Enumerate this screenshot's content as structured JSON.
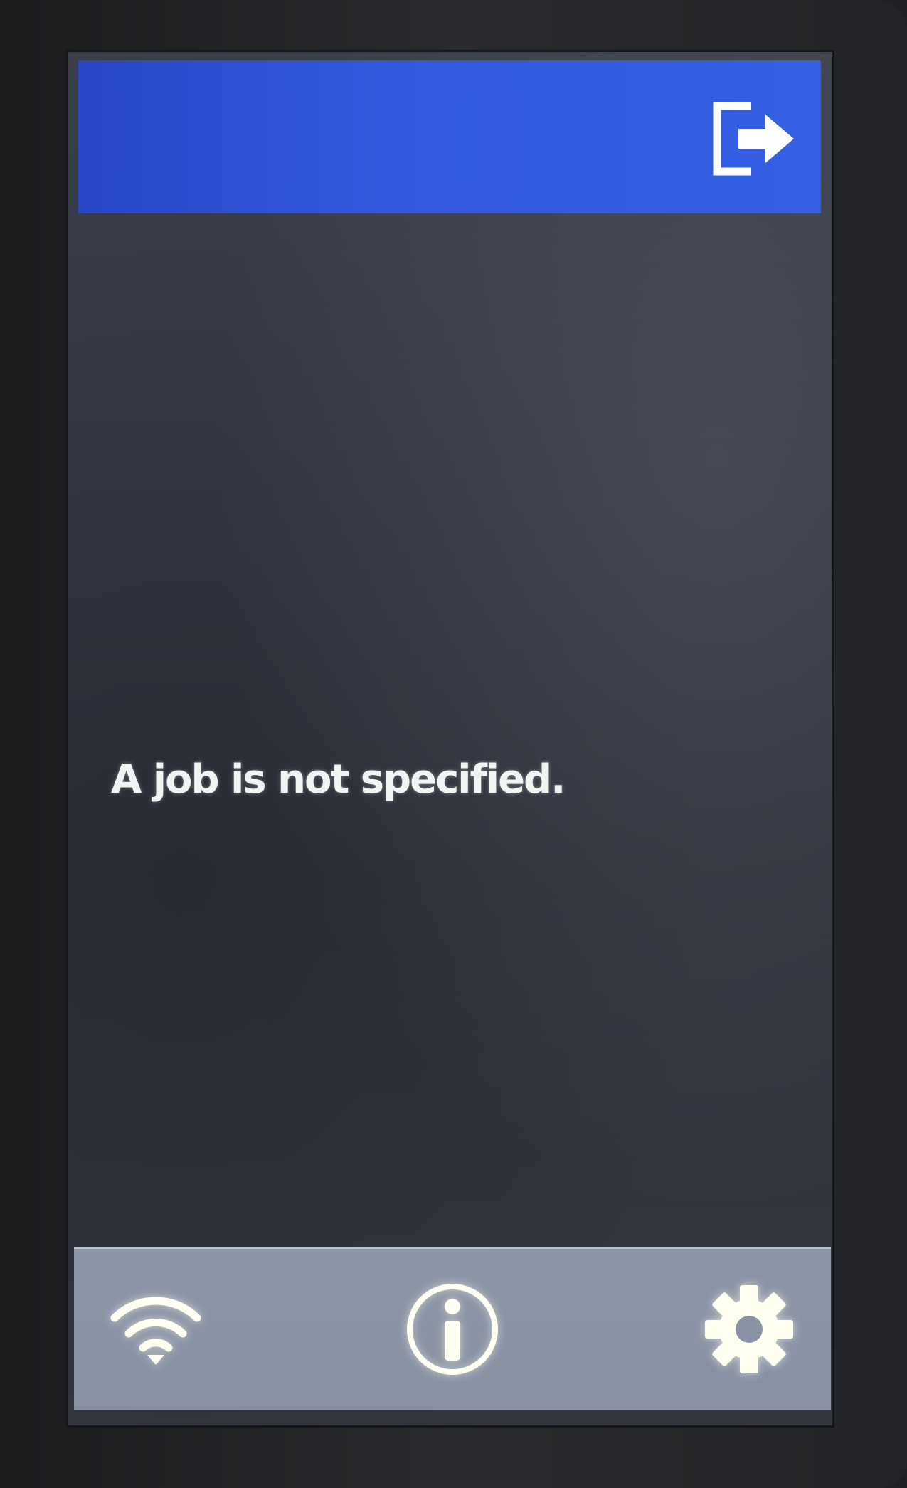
{
  "header": {
    "logout_icon": "logout-icon"
  },
  "main": {
    "message": "A job is not specified."
  },
  "footer": {
    "items": [
      {
        "icon": "wifi-icon"
      },
      {
        "icon": "info-icon"
      },
      {
        "icon": "gear-icon"
      }
    ]
  },
  "colors": {
    "header": "#3258dd",
    "footer": "#8a93a6",
    "screen": "#343844",
    "text": "#f2f4f4"
  }
}
